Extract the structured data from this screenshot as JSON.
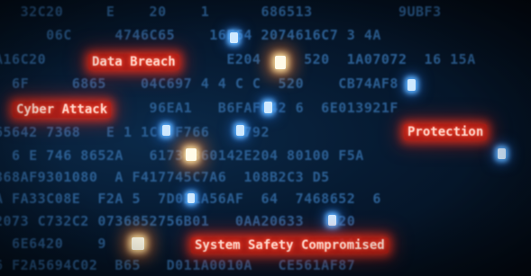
{
  "hex_rows": [
    "   32C20     E    20    1      686513          9UBF3",
    "      06C     4746C65    16E64 2074616C7 3 4A",
    "A16C20                     E204     520  1A07072  16 15A",
    "  6F     6865    04C697 4 4 C C  520    CB74AF8",
    "                  96EA1   B6FAF642 6  6E013921F",
    "65642 7368   E 1 1C  F766   C792",
    "  6 E 746 8652A   61736B60142E204 80100 F5A",
    "368AF9301080  A F417745C7A6  108B2C3 D5",
    "A FA33C08E  F2A 5  7D011A56AF  64  7468652  6",
    "2073 C732C2 0736852756B01   0AA20633   520",
    "  6E6420    9                           1A",
    "6 F2A5694C02  B65   D011A0010A   CE561AF87"
  ],
  "alerts": {
    "data_breach": "Data Breach",
    "cyber_attack": "Cyber Attack",
    "protection": "Protection",
    "system_safety": "System Safety Compromised"
  },
  "colors": {
    "background": "#04101e",
    "code_glyph": "#2c5f93",
    "code_glyph_bright": "#a9d4ff",
    "alert_fill": "#c81e14",
    "alert_glow": "#ff3b1f",
    "highlight_white": "#fffbe8",
    "highlight_blue": "#5db2ff"
  }
}
